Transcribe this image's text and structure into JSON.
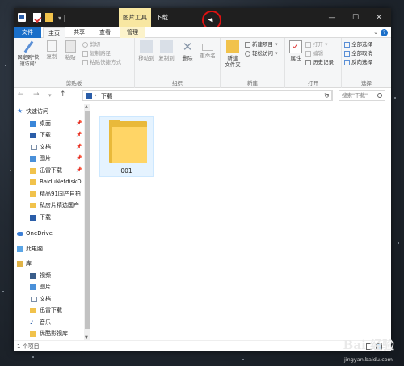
{
  "titlebar": {
    "tool_tab": "图片工具",
    "title": "下载",
    "controls": {
      "minimize": "—",
      "maximize": "☐",
      "close": "✕"
    }
  },
  "tabs": {
    "file": "文件",
    "home": "主页",
    "share": "共享",
    "view": "查看",
    "manage": "管理"
  },
  "ribbon": {
    "clipboard": {
      "pin": "固定到\"快速访问\"",
      "copy": "复制",
      "paste": "粘贴",
      "cut": "剪切",
      "copy_path": "复制路径",
      "paste_shortcut": "粘贴快捷方式",
      "label": "剪贴板"
    },
    "organize": {
      "move_to": "移动到",
      "copy_to": "复制到",
      "delete": "删除",
      "rename": "重命名",
      "label": "组织"
    },
    "new": {
      "new_folder": "新建\n文件夹",
      "new_item": "新建项目 ▾",
      "easy_access": "轻松访问 ▾",
      "label": "新建"
    },
    "open": {
      "properties": "属性",
      "open": "打开 ▾",
      "edit": "编辑",
      "history": "历史记录",
      "label": "打开"
    },
    "select": {
      "select_all": "全部选择",
      "select_none": "全部取消",
      "invert": "反向选择",
      "label": "选择"
    }
  },
  "address": {
    "back": "←",
    "forward": "→",
    "recent": "▾",
    "up": "↑",
    "path": "下载",
    "search_placeholder": "搜索\"下载\""
  },
  "nav": {
    "items": [
      {
        "label": "快速访问",
        "pinned": false
      },
      {
        "label": "桌面",
        "pinned": true
      },
      {
        "label": "下载",
        "pinned": true
      },
      {
        "label": "文档",
        "pinned": true
      },
      {
        "label": "图片",
        "pinned": true
      },
      {
        "label": "迅雷下载",
        "pinned": true
      },
      {
        "label": "BaiduNetdiskD",
        "pinned": false
      },
      {
        "label": "精品91国产自拍",
        "pinned": false
      },
      {
        "label": "私房片精选国产",
        "pinned": false
      },
      {
        "label": "下载",
        "pinned": false
      },
      {
        "label": "OneDrive",
        "pinned": false
      },
      {
        "label": "此电脑",
        "pinned": false
      },
      {
        "label": "库",
        "pinned": false
      },
      {
        "label": "视频",
        "pinned": false
      },
      {
        "label": "图片",
        "pinned": false
      },
      {
        "label": "文档",
        "pinned": false
      },
      {
        "label": "迅雷下载",
        "pinned": false
      },
      {
        "label": "音乐",
        "pinned": false
      },
      {
        "label": "优酷影视库",
        "pinned": false
      }
    ]
  },
  "content": {
    "folder_name": "001"
  },
  "status": {
    "item_count": "1 个项目"
  },
  "watermark": {
    "brand": "Bai 经验",
    "url": "jingyan.baidu.com"
  },
  "colors": {
    "accent": "#1a6fc9",
    "manage_tab": "#fcf3cb",
    "folder": "#ffd566",
    "selection": "#cce4f7"
  }
}
